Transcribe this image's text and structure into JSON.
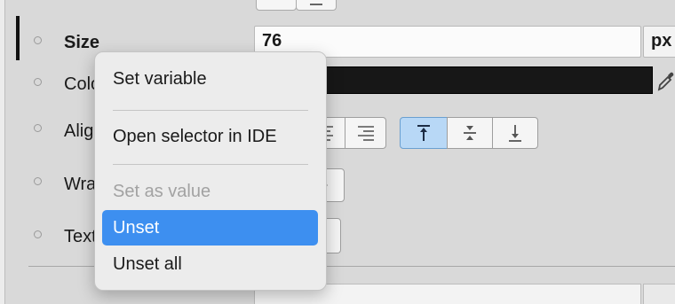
{
  "properties": [
    {
      "label": "Size"
    },
    {
      "label": "Color"
    },
    {
      "label": "Align"
    },
    {
      "label": "Wrap"
    },
    {
      "label": "Text"
    }
  ],
  "size_field": {
    "value": "76",
    "unit": "px"
  },
  "color_field": {
    "value": "#171717"
  },
  "icons": {
    "text_align": [
      "align-center-icon",
      "align-right-icon"
    ],
    "vertical_align": [
      "align-top-icon",
      "align-middle-icon",
      "align-bottom-icon"
    ],
    "color": "eyedropper-icon",
    "wrap": "play-arrow-icon",
    "text": "text-cursor-icon"
  },
  "context_menu": {
    "items": [
      {
        "label": "Set variable",
        "state": "normal"
      },
      {
        "label": "Open selector in IDE",
        "state": "normal"
      },
      {
        "label": "Set as value",
        "state": "disabled"
      },
      {
        "label": "Unset",
        "state": "highlighted"
      },
      {
        "label": "Unset all",
        "state": "normal"
      }
    ]
  },
  "colors": {
    "highlight": "#3d8ff0",
    "active_toggle": "#b8d8f6",
    "swatch": "#171717"
  }
}
